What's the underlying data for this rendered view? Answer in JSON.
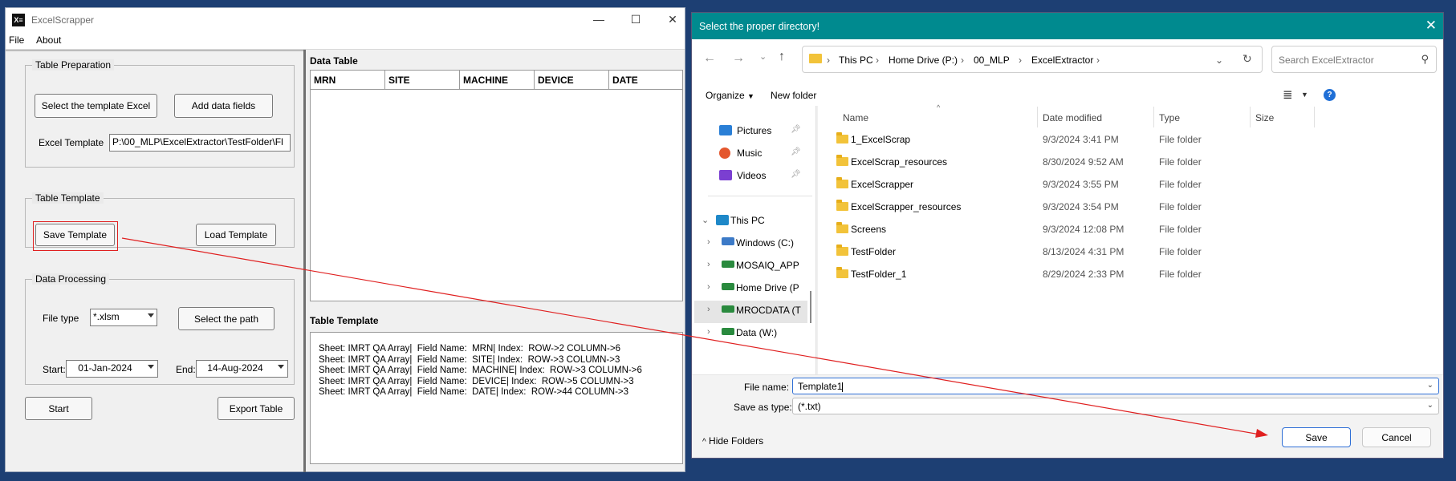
{
  "app": {
    "title": "ExcelScrapper",
    "menu": [
      "File",
      "About"
    ],
    "table_preparation": {
      "legend": "Table Preparation",
      "select_template_btn": "Select the template Excel",
      "add_fields_btn": "Add data fields",
      "excel_template_label": "Excel Template",
      "excel_template_value": "P:\\00_MLP\\ExcelExtractor\\TestFolder\\Fl"
    },
    "table_template": {
      "legend": "Table Template",
      "save_btn": "Save Template",
      "load_btn": "Load Template"
    },
    "data_processing": {
      "legend": "Data Processing",
      "file_type_label": "File type",
      "file_type_value": "*.xlsm",
      "select_path_btn": "Select the path",
      "start_label": "Start:",
      "start_value": "01-Jan-2024",
      "end_label": "End:",
      "end_value": "14-Aug-2024"
    },
    "start_btn": "Start",
    "export_btn": "Export Table",
    "data_table": {
      "title": "Data Table",
      "columns": [
        "MRN",
        "SITE",
        "MACHINE",
        "DEVICE",
        "DATE"
      ]
    },
    "table_template_pane": {
      "title": "Table Template",
      "lines": [
        "Sheet: IMRT QA Array|  Field Name:  MRN| Index:  ROW->2 COLUMN->6",
        "Sheet: IMRT QA Array|  Field Name:  SITE| Index:  ROW->3 COLUMN->3",
        "Sheet: IMRT QA Array|  Field Name:  MACHINE| Index:  ROW->3 COLUMN->6",
        "Sheet: IMRT QA Array|  Field Name:  DEVICE| Index:  ROW->5 COLUMN->3",
        "Sheet: IMRT QA Array|  Field Name:  DATE| Index:  ROW->44 COLUMN->3"
      ]
    }
  },
  "dialog": {
    "title": "Select the proper directory!",
    "breadcrumb": [
      "This PC",
      "Home Drive (P:)",
      "00_MLP",
      "ExcelExtractor"
    ],
    "search_placeholder": "Search ExcelExtractor",
    "organize": "Organize",
    "new_folder": "New folder",
    "nav": {
      "quick": [
        "Pictures",
        "Music",
        "Videos"
      ],
      "this_pc": "This PC",
      "drives": [
        "Windows (C:)",
        "MOSAIQ_APP",
        "Home Drive (P",
        "MROCDATA (T",
        "Data (W:)"
      ]
    },
    "columns": [
      "Name",
      "Date modified",
      "Type",
      "Size"
    ],
    "rows": [
      {
        "name": "1_ExcelScrap",
        "date": "9/3/2024 3:41 PM",
        "type": "File folder"
      },
      {
        "name": "ExcelScrap_resources",
        "date": "8/30/2024 9:52 AM",
        "type": "File folder"
      },
      {
        "name": "ExcelScrapper",
        "date": "9/3/2024 3:55 PM",
        "type": "File folder"
      },
      {
        "name": "ExcelScrapper_resources",
        "date": "9/3/2024 3:54 PM",
        "type": "File folder"
      },
      {
        "name": "Screens",
        "date": "9/3/2024 12:08 PM",
        "type": "File folder"
      },
      {
        "name": "TestFolder",
        "date": "8/13/2024 4:31 PM",
        "type": "File folder"
      },
      {
        "name": "TestFolder_1",
        "date": "8/29/2024 2:33 PM",
        "type": "File folder"
      }
    ],
    "file_name_label": "File name:",
    "file_name_value": "Template1",
    "save_type_label": "Save as type:",
    "save_type_value": "(*.txt)",
    "hide_folders": "Hide Folders",
    "save_btn": "Save",
    "cancel_btn": "Cancel"
  },
  "colors": {
    "dialog_titlebar": "#008a8f",
    "desktop": "#1d3f73",
    "annotation": "#e02020"
  }
}
